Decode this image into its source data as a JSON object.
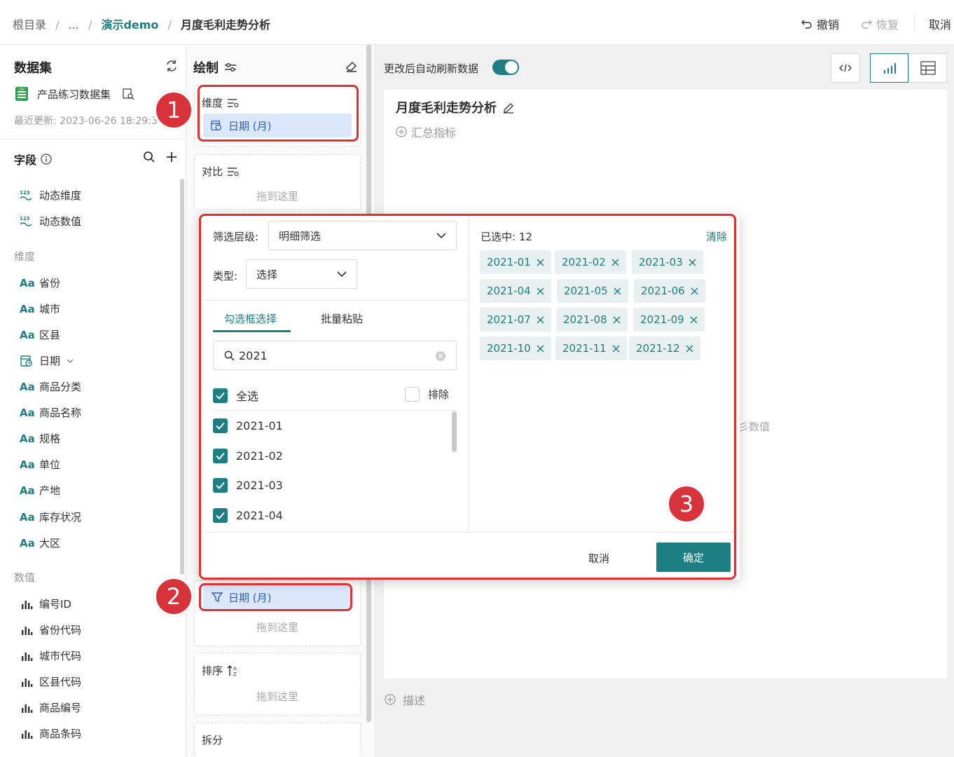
{
  "breadcrumb": {
    "root": "根目录",
    "sep": "/",
    "ellipsis": "...",
    "folder": "演示demo",
    "current": "月度毛利走势分析"
  },
  "toolbar": {
    "undo": "撤销",
    "redo": "恢复",
    "cancel": "取消"
  },
  "left": {
    "dataset_heading": "数据集",
    "dataset_name": "产品练习数据集",
    "last_update": "最近更新: 2023-06-26 18:29:30",
    "fields_heading": "字段",
    "dynamic_fields": [
      "动态维度",
      "动态数值"
    ],
    "dimension_heading": "维度",
    "dimensions": [
      "省份",
      "城市",
      "区县",
      "日期",
      "商品分类",
      "商品名称",
      "规格",
      "单位",
      "产地",
      "库存状况",
      "大区"
    ],
    "measure_heading": "数值",
    "measures": [
      "编号ID",
      "省份代码",
      "城市代码",
      "区县代码",
      "商品编号",
      "商品条码"
    ]
  },
  "middle": {
    "heading": "绘制",
    "dimension_label": "维度",
    "dimension_pill": "日期 (月)",
    "compare_label": "对比",
    "drop_hint": "拖到这里",
    "filter_pill": "日期 (月)",
    "sort_label": "排序",
    "split_label": "拆分"
  },
  "right": {
    "auto_refresh_label": "更改后自动刷新数据",
    "auto_refresh_on": true,
    "chart_title": "月度毛利走势分析",
    "add_metric": "汇总指标",
    "partial_hint": "彡数值",
    "add_desc": "描述"
  },
  "popup": {
    "level_label": "筛选层级:",
    "level_value": "明细筛选",
    "type_label": "类型:",
    "type_value": "选择",
    "tabs": [
      "勾选框选择",
      "批量粘贴"
    ],
    "search_value": "2021",
    "select_all": "全选",
    "exclude": "排除",
    "items": [
      "2021-01",
      "2021-02",
      "2021-03",
      "2021-04"
    ],
    "selected_label": "已选中: 12",
    "clear": "清除",
    "tags": [
      "2021-01",
      "2021-02",
      "2021-03",
      "2021-04",
      "2021-05",
      "2021-06",
      "2021-07",
      "2021-08",
      "2021-09",
      "2021-10",
      "2021-11",
      "2021-12"
    ],
    "cancel": "取消",
    "confirm": "确定"
  },
  "badges": [
    "1",
    "2",
    "3"
  ],
  "colors": {
    "accent": "#1e7f82",
    "highlight": "#e03131",
    "pill_bg": "#dbe7fb"
  }
}
